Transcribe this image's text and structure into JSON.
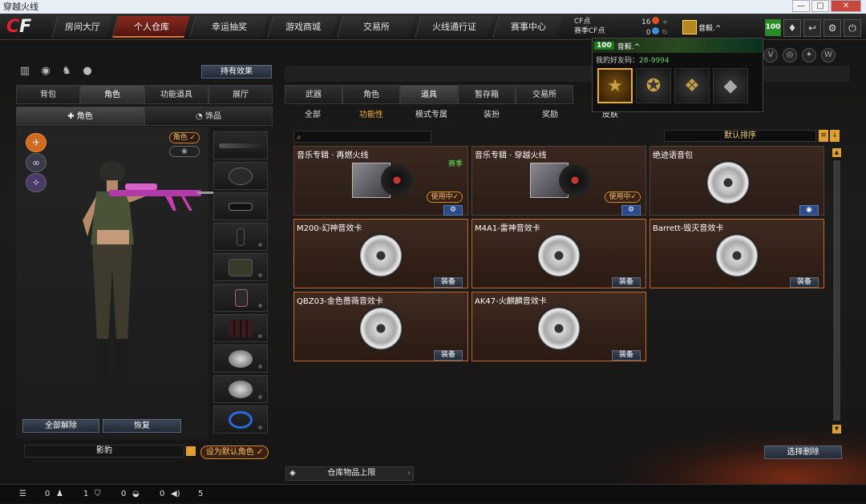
{
  "window": {
    "title": "穿越火线",
    "min": "—",
    "max": "□",
    "close": "✕"
  },
  "logo": {
    "cf": "C",
    "rest": "F"
  },
  "nav": [
    "房间大厅",
    "个人仓库",
    "幸运抽奖",
    "游戏商城",
    "交易所",
    "火线通行证",
    "赛事中心"
  ],
  "nav_active": "个人仓库",
  "currency": {
    "cf_label": "CF点",
    "match_label": "赛季CF点",
    "cf_value": "16",
    "match_value": "0"
  },
  "user": {
    "level": "100",
    "name": "音毅.^"
  },
  "popup": {
    "level": "100",
    "name": "音毅.^",
    "friend_code_label": "我的好友码：",
    "friend_code": "28-9994"
  },
  "left": {
    "effects_button": "持有效果",
    "tabs": [
      "背包",
      "角色",
      "功能道具",
      "展厅"
    ],
    "active_tab": "角色",
    "subtabs": [
      "角色",
      "饰品"
    ],
    "role_pill": "角色 ✓",
    "release_all": "全部解除",
    "restore": "恢复",
    "character_name": "影豹",
    "set_default": "设为默认角色 ✓"
  },
  "right": {
    "tabs": [
      "武器",
      "角色",
      "道具",
      "暂存箱",
      "交易所"
    ],
    "active_tab": "道具",
    "subtabs": [
      "全部",
      "功能性",
      "模式专属",
      "装扮",
      "奖励",
      "皮肤"
    ],
    "active_subtab": "功能性",
    "sort_label": "默认排序",
    "bulk_delete": "选择删除",
    "capacity": "仓库物品上限",
    "items": [
      {
        "title": "音乐专辑 · 再燃火线",
        "season": "赛季",
        "using": "使用中✓",
        "type": "album"
      },
      {
        "title": "音乐专辑 · 穿越火线",
        "season": "",
        "using": "使用中✓",
        "type": "album"
      },
      {
        "title": "绝迹语音包",
        "season": "",
        "using": "",
        "type": "voice"
      },
      {
        "title": "M200-幻神音效卡",
        "equip": "装备",
        "type": "disc"
      },
      {
        "title": "M4A1-雷神音效卡",
        "equip": "装备",
        "type": "disc"
      },
      {
        "title": "Barrett-毁灭音效卡",
        "equip": "装备",
        "type": "disc"
      },
      {
        "title": "QBZ03-金色蔷薇音效卡",
        "equip": "装备",
        "type": "disc"
      },
      {
        "title": "AK47-火麒麟音效卡",
        "equip": "装备",
        "type": "disc"
      }
    ]
  },
  "bottom": {
    "v1": "0",
    "v2": "1",
    "v3": "0",
    "v4": "0",
    "v5": "5"
  },
  "colors": {
    "accent": "#e0a030",
    "nav_active": "#8a2a1e",
    "season": "#5fe05f"
  }
}
